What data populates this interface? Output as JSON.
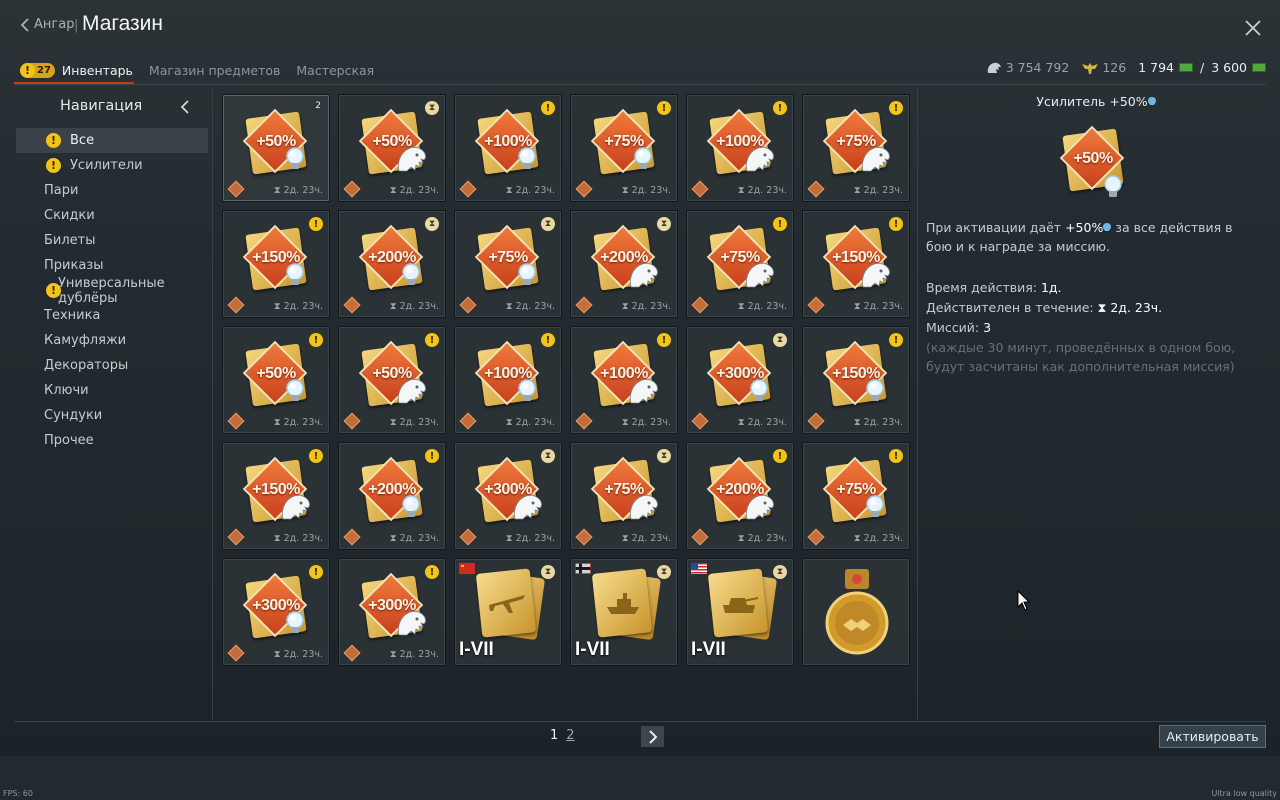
{
  "header": {
    "back_label": "Ангар",
    "separator": "|",
    "title": "Магазин"
  },
  "tabs": [
    {
      "label": "Инвентарь",
      "badge": "27",
      "active": true
    },
    {
      "label": "Магазин предметов",
      "active": false
    },
    {
      "label": "Мастерская",
      "active": false
    }
  ],
  "currencies": {
    "lions": "3 754 792",
    "eagles": "126",
    "cash_current": "1 794",
    "cash_separator": "/",
    "cash_max": "3 600"
  },
  "sidebar": {
    "title": "Навигация",
    "items": [
      {
        "label": "Все",
        "warn": true,
        "selected": true
      },
      {
        "label": "Усилители",
        "warn": true
      },
      {
        "label": "Пари"
      },
      {
        "label": "Скидки"
      },
      {
        "label": "Билеты"
      },
      {
        "label": "Приказы"
      },
      {
        "label": "Универсальные дублёры",
        "warn": true
      },
      {
        "label": "Техника"
      },
      {
        "label": "Камуфляжи"
      },
      {
        "label": "Декораторы"
      },
      {
        "label": "Ключи"
      },
      {
        "label": "Сундуки"
      },
      {
        "label": "Прочее"
      }
    ]
  },
  "grid": {
    "timer": "2д. 23ч.",
    "items": [
      {
        "type": "booster",
        "pct": "+50%",
        "bonus": "bulb",
        "corner": "count",
        "count": "2"
      },
      {
        "type": "booster",
        "pct": "+50%",
        "bonus": "lion",
        "corner": "hourglass"
      },
      {
        "type": "booster",
        "pct": "+100%",
        "bonus": "bulb",
        "corner": "warn"
      },
      {
        "type": "booster",
        "pct": "+75%",
        "bonus": "bulb",
        "corner": "warn"
      },
      {
        "type": "booster",
        "pct": "+100%",
        "bonus": "lion",
        "corner": "warn"
      },
      {
        "type": "booster",
        "pct": "+75%",
        "bonus": "lion",
        "corner": "warn"
      },
      {
        "type": "booster",
        "pct": "+150%",
        "bonus": "bulb",
        "corner": "warn"
      },
      {
        "type": "booster",
        "pct": "+200%",
        "bonus": "bulb",
        "corner": "hourglass"
      },
      {
        "type": "booster",
        "pct": "+75%",
        "bonus": "bulb",
        "corner": "hourglass"
      },
      {
        "type": "booster",
        "pct": "+200%",
        "bonus": "lion",
        "corner": "hourglass"
      },
      {
        "type": "booster",
        "pct": "+75%",
        "bonus": "lion",
        "corner": "warn"
      },
      {
        "type": "booster",
        "pct": "+150%",
        "bonus": "lion",
        "corner": "warn"
      },
      {
        "type": "booster",
        "pct": "+50%",
        "bonus": "bulb",
        "corner": "warn"
      },
      {
        "type": "booster",
        "pct": "+50%",
        "bonus": "lion",
        "corner": "warn"
      },
      {
        "type": "booster",
        "pct": "+100%",
        "bonus": "bulb",
        "corner": "warn"
      },
      {
        "type": "booster",
        "pct": "+100%",
        "bonus": "lion",
        "corner": "warn"
      },
      {
        "type": "booster",
        "pct": "+300%",
        "bonus": "bulb",
        "corner": "hourglass"
      },
      {
        "type": "booster",
        "pct": "+150%",
        "bonus": "bulb",
        "corner": "warn"
      },
      {
        "type": "booster",
        "pct": "+150%",
        "bonus": "lion",
        "corner": "warn"
      },
      {
        "type": "booster",
        "pct": "+200%",
        "bonus": "bulb",
        "corner": "warn"
      },
      {
        "type": "booster",
        "pct": "+300%",
        "bonus": "lion",
        "corner": "hourglass"
      },
      {
        "type": "booster",
        "pct": "+75%",
        "bonus": "lion",
        "corner": "hourglass"
      },
      {
        "type": "booster",
        "pct": "+200%",
        "bonus": "lion",
        "corner": "warn"
      },
      {
        "type": "booster",
        "pct": "+75%",
        "bonus": "bulb",
        "corner": "warn"
      },
      {
        "type": "booster",
        "pct": "+300%",
        "bonus": "bulb",
        "corner": "warn"
      },
      {
        "type": "booster",
        "pct": "+300%",
        "bonus": "lion",
        "corner": "warn"
      },
      {
        "type": "crew",
        "rank": "I-VII",
        "vehicle": "aircraft",
        "flag": "ussr",
        "corner": "hourglass"
      },
      {
        "type": "crew",
        "rank": "I-VII",
        "vehicle": "ship",
        "flag": "germany",
        "corner": "hourglass"
      },
      {
        "type": "crew",
        "rank": "I-VII",
        "vehicle": "tank",
        "flag": "usa",
        "corner": "hourglass"
      },
      {
        "type": "medal"
      }
    ]
  },
  "detail": {
    "title": "Усилитель +50%",
    "desc_prefix": "При активации даёт ",
    "desc_value": "+50%",
    "desc_suffix": " за все действия в бою и к награде за миссию.",
    "duration_label": "Время действия: ",
    "duration_value": "1д.",
    "valid_label": "Действителен в течение: ",
    "valid_value": "2д. 23ч.",
    "missions_label": "Миссий: ",
    "missions_value": "3",
    "note": "(каждые 30 минут, проведённых в одном бою, будут засчитаны как дополнительная миссия)"
  },
  "pagination": {
    "current": "1",
    "other": "2"
  },
  "activate_label": "Активировать",
  "footer": {
    "fps": "FPS: 60",
    "quality": "Ultra low quality"
  },
  "colors": {
    "accent": "#c43a1e",
    "warn": "#f2c418",
    "booster": "#e05a2a",
    "gold": "#e5bb55"
  }
}
